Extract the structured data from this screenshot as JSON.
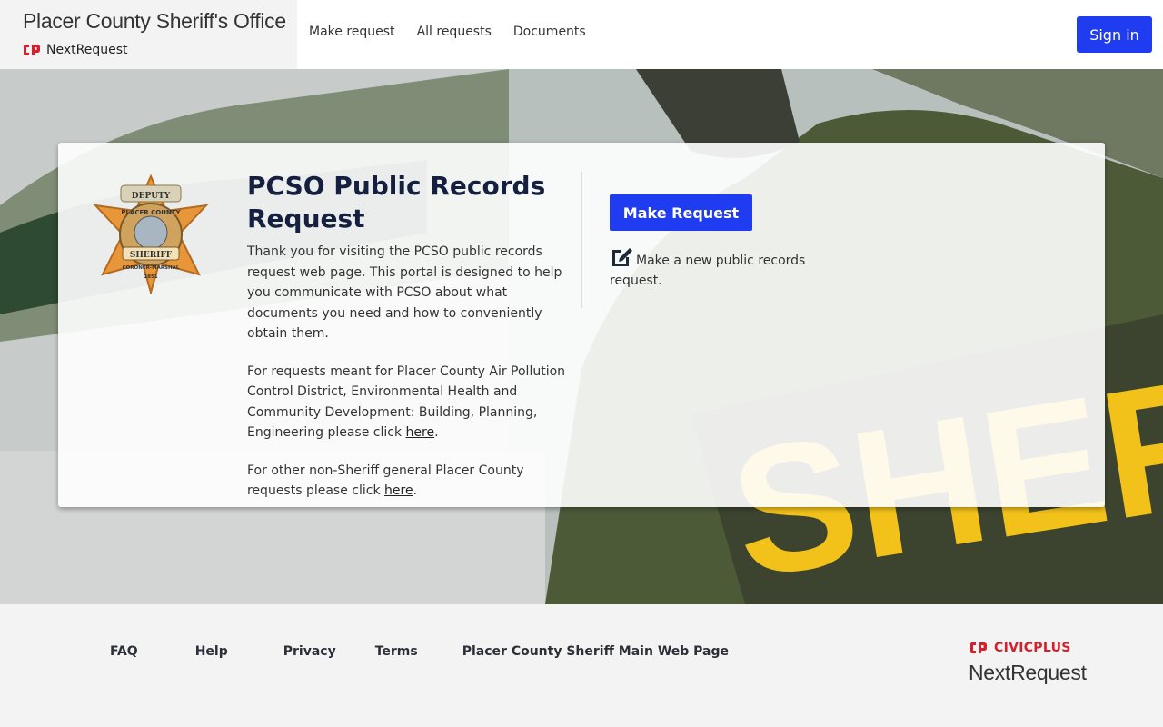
{
  "header": {
    "site_title": "Placer County Sheriff's Office",
    "brand_sub": "NextRequest",
    "nav": [
      "Make request",
      "All requests",
      "Documents"
    ],
    "signin_label": "Sign in"
  },
  "hero": {
    "background_text": "SHERIFF"
  },
  "card": {
    "title": "PCSO Public Records Request",
    "paragraph1": "Thank you for visiting the PCSO public records request web page.  This portal is designed to help you communicate with PCSO about what documents you need and how to conveniently obtain them.",
    "paragraph2_prefix": "For requests meant for Placer County Air Pollution Control District, Environmental Health and Community Development: Building, Planning, Engineering please click ",
    "paragraph2_link": "here",
    "paragraph2_suffix": ".",
    "paragraph3_prefix": "For other non-Sheriff general Placer County requests please click ",
    "paragraph3_link": "here",
    "paragraph3_suffix": ".",
    "make_request_label": "Make Request",
    "make_request_desc": "Make a new public records request.",
    "badge_texts": {
      "top": "DEPUTY",
      "ring": "PLACER COUNTY",
      "center": "SHERIFF",
      "bottom": "CORONER-MARSHAL",
      "year": "1851"
    }
  },
  "footer": {
    "links": [
      "FAQ",
      "Help",
      "Privacy",
      "Terms",
      "Placer County Sheriff Main Web Page"
    ],
    "civic_label": "CIVICPLUS",
    "nextrequest_label": "NextRequest"
  },
  "colors": {
    "primary_button": "#1f3cf0",
    "civic_red": "#d3202a",
    "badge_gold": "#e8963a",
    "sheriff_yellow": "#f2c21a"
  }
}
